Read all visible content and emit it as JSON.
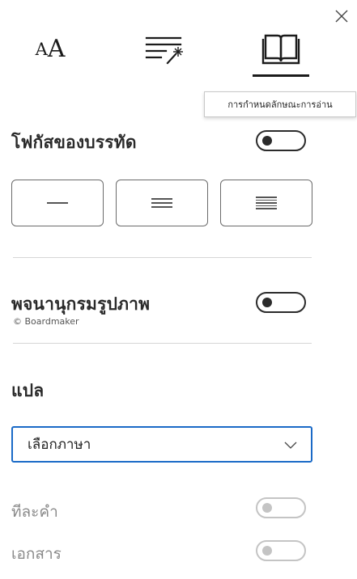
{
  "tabs": [
    {
      "name": "text-preferences",
      "icon": "text-size-icon",
      "glyph_big": "A",
      "glyph_small": "A"
    },
    {
      "name": "grammar-options",
      "icon": "grammar-wand-icon"
    },
    {
      "name": "reading-preferences",
      "icon": "open-book-icon",
      "selected": true
    }
  ],
  "tooltip": "การกำหนดลักษณะการอ่าน",
  "line_focus": {
    "title": "โฟกัสของบรรทัด",
    "enabled": false,
    "options": [
      {
        "name": "one-line",
        "lines": 1
      },
      {
        "name": "three-lines",
        "lines": 3
      },
      {
        "name": "five-lines",
        "lines": 5
      }
    ]
  },
  "picture_dictionary": {
    "title": "พจนานุกรมรูปภาพ",
    "credit": "© Boardmaker",
    "enabled": false
  },
  "translate": {
    "title": "แปล",
    "select_value": "เลือกภาษา",
    "by_word_label": "ทีละคำ",
    "by_word_enabled": false,
    "document_label": "เอกสาร",
    "document_enabled": false
  },
  "colors": {
    "accent": "#1a6ac7",
    "text": "#2a2a2a",
    "muted": "#8a8a8a"
  }
}
